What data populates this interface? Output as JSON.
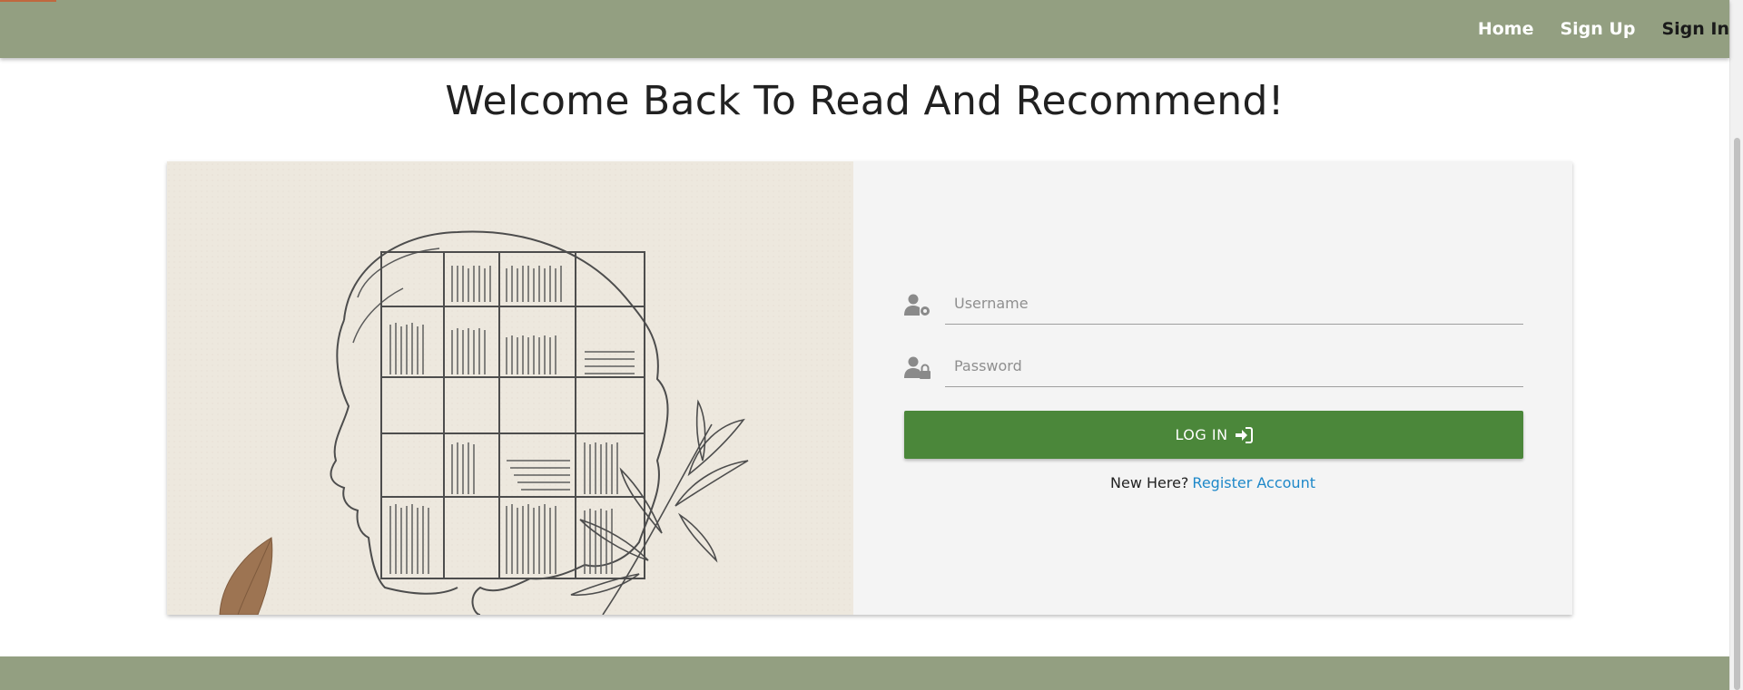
{
  "nav": {
    "links": [
      {
        "label": "Home"
      },
      {
        "label": "Sign Up"
      },
      {
        "label": "Sign In"
      }
    ],
    "active": "Sign In"
  },
  "page": {
    "title": "Welcome Back To Read And Recommend!"
  },
  "login_form": {
    "username": {
      "placeholder": "Username",
      "value": "",
      "icon": "user-gear-icon"
    },
    "password": {
      "placeholder": "Password",
      "value": "",
      "icon": "user-lock-icon"
    },
    "submit_label": "LOG IN",
    "submit_icon": "sign-in-icon",
    "register_prompt": "New Here?",
    "register_link": "Register Account"
  },
  "colors": {
    "navbar": "#939f81",
    "button": "#4b873a",
    "link": "#1e88c9",
    "card": "#f4f4f4"
  }
}
